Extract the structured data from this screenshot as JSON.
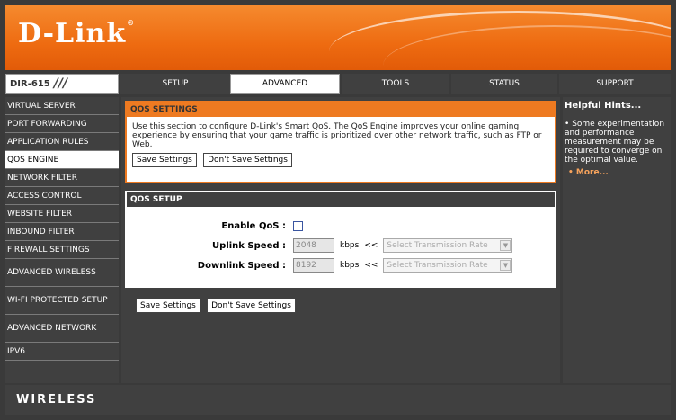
{
  "brand": {
    "logo": "D-Link",
    "reg": "®",
    "model": "DIR-615",
    "slashes": "///"
  },
  "nav": {
    "tabs": [
      {
        "label": "SETUP"
      },
      {
        "label": "ADVANCED",
        "active": true
      },
      {
        "label": "TOOLS"
      },
      {
        "label": "STATUS"
      },
      {
        "label": "SUPPORT"
      }
    ]
  },
  "sidebar": {
    "items": [
      {
        "label": "VIRTUAL SERVER"
      },
      {
        "label": "PORT FORWARDING"
      },
      {
        "label": "APPLICATION RULES"
      },
      {
        "label": "QOS ENGINE",
        "active": true
      },
      {
        "label": "NETWORK FILTER"
      },
      {
        "label": "ACCESS CONTROL"
      },
      {
        "label": "WEBSITE FILTER"
      },
      {
        "label": "INBOUND FILTER"
      },
      {
        "label": "FIREWALL SETTINGS"
      },
      {
        "label": "ADVANCED WIRELESS"
      },
      {
        "label": "WI-FI PROTECTED SETUP"
      },
      {
        "label": "ADVANCED NETWORK"
      },
      {
        "label": "IPV6"
      }
    ]
  },
  "qos_settings": {
    "title": "QOS SETTINGS",
    "description": "Use this section to configure D-Link's Smart QoS. The QoS Engine improves your online gaming experience by ensuring that your game traffic is prioritized over other network traffic, such as FTP or Web.",
    "save_label": "Save Settings",
    "dont_save_label": "Don't Save Settings"
  },
  "qos_setup": {
    "title": "QOS SETUP",
    "enable_label": "Enable QoS :",
    "enable_checked": false,
    "uplink_label": "Uplink Speed :",
    "uplink_value": "2048",
    "downlink_label": "Downlink Speed :",
    "downlink_value": "8192",
    "unit": "kbps",
    "arrow": "<<",
    "rate_placeholder": "Select Transmission Rate"
  },
  "bottom": {
    "save_label": "Save Settings",
    "dont_save_label": "Don't Save Settings"
  },
  "hints": {
    "title": "Helpful Hints...",
    "bullet": "•",
    "text": "Some experimentation and performance measurement may be required to converge on the optimal value.",
    "more": "More..."
  },
  "footer": {
    "label": "WIRELESS"
  },
  "colors": {
    "accent": "#ee7a21",
    "panel_dark": "#404040",
    "link": "#f7a35c"
  }
}
